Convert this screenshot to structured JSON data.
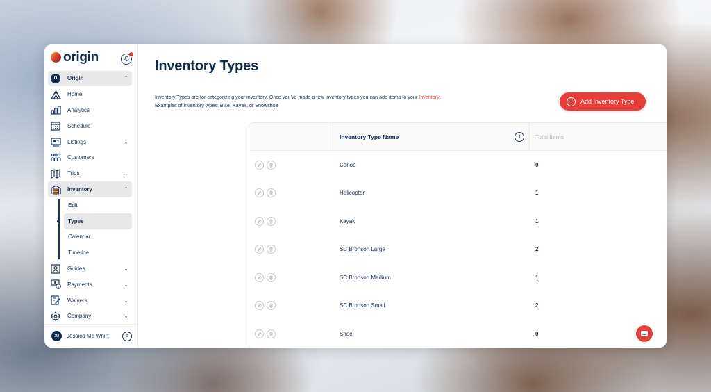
{
  "brand": {
    "name": "origin",
    "accent": "#e83e3a",
    "navy": "#0f2a4a"
  },
  "sidebar": {
    "org": {
      "badge": "O",
      "label": "Origin"
    },
    "items": [
      {
        "label": "Home",
        "icon": "mountain-icon",
        "chevron": ""
      },
      {
        "label": "Analytics",
        "icon": "bar-chart-icon",
        "chevron": ""
      },
      {
        "label": "Schedule",
        "icon": "calendar-icon",
        "chevron": ""
      },
      {
        "label": "Listings",
        "icon": "listing-icon",
        "chevron": "⌄"
      },
      {
        "label": "Customers",
        "icon": "people-icon",
        "chevron": ""
      },
      {
        "label": "Trips",
        "icon": "map-icon",
        "chevron": "⌄"
      },
      {
        "label": "Inventory",
        "icon": "garage-icon",
        "chevron": "⌃"
      }
    ],
    "inventory_sub": [
      {
        "label": "Edit"
      },
      {
        "label": "Types"
      },
      {
        "label": "Calendar"
      },
      {
        "label": "Timeline"
      }
    ],
    "items_after": [
      {
        "label": "Guides",
        "icon": "guide-icon",
        "chevron": "⌄"
      },
      {
        "label": "Payments",
        "icon": "payments-icon",
        "chevron": "⌄"
      },
      {
        "label": "Waivers",
        "icon": "waiver-icon",
        "chevron": "⌄"
      },
      {
        "label": "Company",
        "icon": "gear-icon",
        "chevron": "⌄"
      }
    ],
    "user": {
      "initials": "JM",
      "name": "Jessica Mc Whirt"
    }
  },
  "main": {
    "title": "Inventory Types",
    "description_1": "Inventory Types are for categorizing your inventory. Once you've made a few inventory types you can add items to your ",
    "description_link": "Inventory.",
    "description_2": "Examples of inventory types: Bike, Kayak, or Snowshoe",
    "add_button": "Add Inventory Type",
    "table": {
      "columns": [
        "",
        "Inventory Type Name",
        "Total Items"
      ],
      "rows": [
        {
          "name": "Canoe",
          "total": "0"
        },
        {
          "name": "Helicopter",
          "total": "1"
        },
        {
          "name": "Kayak",
          "total": "1"
        },
        {
          "name": "SC Bronson Large",
          "total": "2"
        },
        {
          "name": "SC Bronson Medium",
          "total": "1"
        },
        {
          "name": "SC Bronson Small",
          "total": "2"
        },
        {
          "name": "Shoe",
          "total": "0"
        }
      ]
    }
  }
}
